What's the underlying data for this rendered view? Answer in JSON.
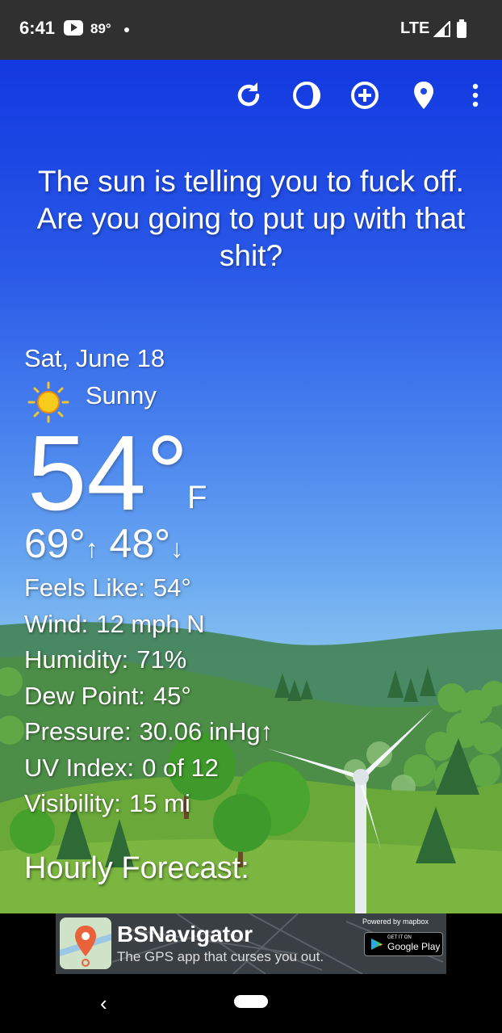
{
  "status": {
    "time": "6:41",
    "temp": "89°",
    "network": "LTE"
  },
  "toolbar": {
    "icons": [
      "refresh-icon",
      "theme-icon",
      "add-location-icon",
      "location-pin-icon",
      "more-icon"
    ]
  },
  "tagline": "The sun is telling you to fuck off. Are you going to put up with that shit?",
  "weather": {
    "date": "Sat, June 18",
    "condition": "Sunny",
    "temperature": "54°",
    "unit": "F",
    "high": "69°",
    "high_arrow": "↑",
    "low": "48°",
    "low_arrow": "↓",
    "details": [
      {
        "label": "Feels Like:",
        "value": "54°"
      },
      {
        "label": "Wind:",
        "value": "12 mph N"
      },
      {
        "label": "Humidity:",
        "value": "71%"
      },
      {
        "label": "Dew Point:",
        "value": "45°"
      },
      {
        "label": "Pressure:",
        "value": "30.06 inHg↑"
      },
      {
        "label": "UV Index:",
        "value": "0 of 12"
      },
      {
        "label": "Visibility:",
        "value": "15 mi"
      }
    ],
    "hourly_heading": "Hourly Forecast:"
  },
  "ad": {
    "title": "BSNavigator",
    "subtitle": "The GPS app that curses you out.",
    "powered_by": "Powered by mapbox",
    "store_small": "GET IT ON",
    "store_big": "Google Play"
  },
  "colors": {
    "sky_top": "#1238e0",
    "sky_bottom": "#86c0f0",
    "grass": "#6aa83a"
  }
}
